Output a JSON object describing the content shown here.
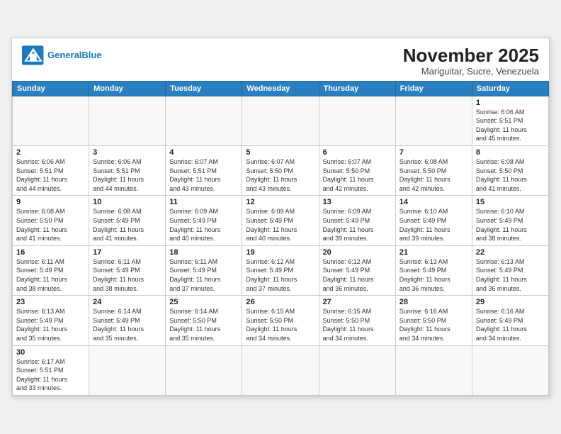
{
  "header": {
    "logo_general": "General",
    "logo_blue": "Blue",
    "month_title": "November 2025",
    "location": "Mariguitar, Sucre, Venezuela"
  },
  "weekdays": [
    "Sunday",
    "Monday",
    "Tuesday",
    "Wednesday",
    "Thursday",
    "Friday",
    "Saturday"
  ],
  "weeks": [
    [
      {
        "day": "",
        "info": ""
      },
      {
        "day": "",
        "info": ""
      },
      {
        "day": "",
        "info": ""
      },
      {
        "day": "",
        "info": ""
      },
      {
        "day": "",
        "info": ""
      },
      {
        "day": "",
        "info": ""
      },
      {
        "day": "1",
        "info": "Sunrise: 6:06 AM\nSunset: 5:51 PM\nDaylight: 11 hours\nand 45 minutes."
      }
    ],
    [
      {
        "day": "2",
        "info": "Sunrise: 6:06 AM\nSunset: 5:51 PM\nDaylight: 11 hours\nand 44 minutes."
      },
      {
        "day": "3",
        "info": "Sunrise: 6:06 AM\nSunset: 5:51 PM\nDaylight: 11 hours\nand 44 minutes."
      },
      {
        "day": "4",
        "info": "Sunrise: 6:07 AM\nSunset: 5:51 PM\nDaylight: 11 hours\nand 43 minutes."
      },
      {
        "day": "5",
        "info": "Sunrise: 6:07 AM\nSunset: 5:50 PM\nDaylight: 11 hours\nand 43 minutes."
      },
      {
        "day": "6",
        "info": "Sunrise: 6:07 AM\nSunset: 5:50 PM\nDaylight: 11 hours\nand 42 minutes."
      },
      {
        "day": "7",
        "info": "Sunrise: 6:08 AM\nSunset: 5:50 PM\nDaylight: 11 hours\nand 42 minutes."
      },
      {
        "day": "8",
        "info": "Sunrise: 6:08 AM\nSunset: 5:50 PM\nDaylight: 11 hours\nand 41 minutes."
      }
    ],
    [
      {
        "day": "9",
        "info": "Sunrise: 6:08 AM\nSunset: 5:50 PM\nDaylight: 11 hours\nand 41 minutes."
      },
      {
        "day": "10",
        "info": "Sunrise: 6:08 AM\nSunset: 5:49 PM\nDaylight: 11 hours\nand 41 minutes."
      },
      {
        "day": "11",
        "info": "Sunrise: 6:09 AM\nSunset: 5:49 PM\nDaylight: 11 hours\nand 40 minutes."
      },
      {
        "day": "12",
        "info": "Sunrise: 6:09 AM\nSunset: 5:49 PM\nDaylight: 11 hours\nand 40 minutes."
      },
      {
        "day": "13",
        "info": "Sunrise: 6:09 AM\nSunset: 5:49 PM\nDaylight: 11 hours\nand 39 minutes."
      },
      {
        "day": "14",
        "info": "Sunrise: 6:10 AM\nSunset: 5:49 PM\nDaylight: 11 hours\nand 39 minutes."
      },
      {
        "day": "15",
        "info": "Sunrise: 6:10 AM\nSunset: 5:49 PM\nDaylight: 11 hours\nand 38 minutes."
      }
    ],
    [
      {
        "day": "16",
        "info": "Sunrise: 6:11 AM\nSunset: 5:49 PM\nDaylight: 11 hours\nand 38 minutes."
      },
      {
        "day": "17",
        "info": "Sunrise: 6:11 AM\nSunset: 5:49 PM\nDaylight: 11 hours\nand 38 minutes."
      },
      {
        "day": "18",
        "info": "Sunrise: 6:11 AM\nSunset: 5:49 PM\nDaylight: 11 hours\nand 37 minutes."
      },
      {
        "day": "19",
        "info": "Sunrise: 6:12 AM\nSunset: 5:49 PM\nDaylight: 11 hours\nand 37 minutes."
      },
      {
        "day": "20",
        "info": "Sunrise: 6:12 AM\nSunset: 5:49 PM\nDaylight: 11 hours\nand 36 minutes."
      },
      {
        "day": "21",
        "info": "Sunrise: 6:13 AM\nSunset: 5:49 PM\nDaylight: 11 hours\nand 36 minutes."
      },
      {
        "day": "22",
        "info": "Sunrise: 6:13 AM\nSunset: 5:49 PM\nDaylight: 11 hours\nand 36 minutes."
      }
    ],
    [
      {
        "day": "23",
        "info": "Sunrise: 6:13 AM\nSunset: 5:49 PM\nDaylight: 11 hours\nand 35 minutes."
      },
      {
        "day": "24",
        "info": "Sunrise: 6:14 AM\nSunset: 5:49 PM\nDaylight: 11 hours\nand 35 minutes."
      },
      {
        "day": "25",
        "info": "Sunrise: 6:14 AM\nSunset: 5:50 PM\nDaylight: 11 hours\nand 35 minutes."
      },
      {
        "day": "26",
        "info": "Sunrise: 6:15 AM\nSunset: 5:50 PM\nDaylight: 11 hours\nand 34 minutes."
      },
      {
        "day": "27",
        "info": "Sunrise: 6:15 AM\nSunset: 5:50 PM\nDaylight: 11 hours\nand 34 minutes."
      },
      {
        "day": "28",
        "info": "Sunrise: 6:16 AM\nSunset: 5:50 PM\nDaylight: 11 hours\nand 34 minutes."
      },
      {
        "day": "29",
        "info": "Sunrise: 6:16 AM\nSunset: 5:49 PM\nDaylight: 11 hours\nand 34 minutes."
      }
    ],
    [
      {
        "day": "30",
        "info": "Sunrise: 6:17 AM\nSunset: 5:51 PM\nDaylight: 11 hours\nand 33 minutes."
      },
      {
        "day": "",
        "info": ""
      },
      {
        "day": "",
        "info": ""
      },
      {
        "day": "",
        "info": ""
      },
      {
        "day": "",
        "info": ""
      },
      {
        "day": "",
        "info": ""
      },
      {
        "day": "",
        "info": ""
      }
    ]
  ]
}
